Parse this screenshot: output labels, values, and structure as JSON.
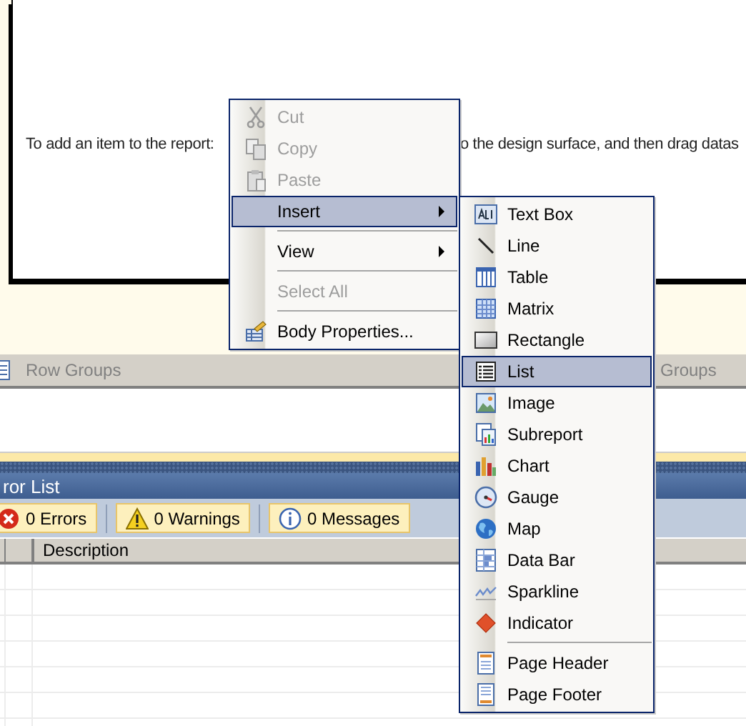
{
  "design_surface": {
    "hint_left": "To add an item to the report:",
    "hint_right": "o the design surface, and then drag datas"
  },
  "grouping_pane": {
    "row_groups": "Row Groups",
    "column_groups": "Groups"
  },
  "error_list": {
    "title": "ror List",
    "filters": [
      {
        "label": "0 Errors",
        "pressed": true
      },
      {
        "label": "0 Warnings",
        "pressed": true
      },
      {
        "label": "0 Messages",
        "pressed": true
      }
    ],
    "columns": [
      "Description"
    ]
  },
  "context_menu": {
    "items": [
      {
        "kind": "item",
        "label": "Cut",
        "disabled": true,
        "selected": false,
        "submenu": false
      },
      {
        "kind": "item",
        "label": "Copy",
        "disabled": true,
        "selected": false,
        "submenu": false
      },
      {
        "kind": "item",
        "label": "Paste",
        "disabled": true,
        "selected": false,
        "submenu": false
      },
      {
        "kind": "item",
        "label": "Insert",
        "disabled": false,
        "selected": true,
        "submenu": true
      },
      {
        "kind": "separator"
      },
      {
        "kind": "item",
        "label": "View",
        "disabled": false,
        "selected": false,
        "submenu": true
      },
      {
        "kind": "separator"
      },
      {
        "kind": "item",
        "label": "Select All",
        "disabled": true,
        "selected": false,
        "submenu": false
      },
      {
        "kind": "separator"
      },
      {
        "kind": "item",
        "label": "Body Properties...",
        "disabled": false,
        "selected": false,
        "submenu": false
      }
    ]
  },
  "insert_submenu": {
    "items": [
      {
        "kind": "item",
        "label": "Text Box",
        "selected": false
      },
      {
        "kind": "item",
        "label": "Line",
        "selected": false
      },
      {
        "kind": "item",
        "label": "Table",
        "selected": false
      },
      {
        "kind": "item",
        "label": "Matrix",
        "selected": false
      },
      {
        "kind": "item",
        "label": "Rectangle",
        "selected": false
      },
      {
        "kind": "item",
        "label": "List",
        "selected": true
      },
      {
        "kind": "item",
        "label": "Image",
        "selected": false
      },
      {
        "kind": "item",
        "label": "Subreport",
        "selected": false
      },
      {
        "kind": "item",
        "label": "Chart",
        "selected": false
      },
      {
        "kind": "item",
        "label": "Gauge",
        "selected": false
      },
      {
        "kind": "item",
        "label": "Map",
        "selected": false
      },
      {
        "kind": "item",
        "label": "Data Bar",
        "selected": false
      },
      {
        "kind": "item",
        "label": "Sparkline",
        "selected": false
      },
      {
        "kind": "item",
        "label": "Indicator",
        "selected": false
      },
      {
        "kind": "separator"
      },
      {
        "kind": "item",
        "label": "Page Header",
        "selected": false
      },
      {
        "kind": "item",
        "label": "Page Footer",
        "selected": false
      }
    ]
  }
}
